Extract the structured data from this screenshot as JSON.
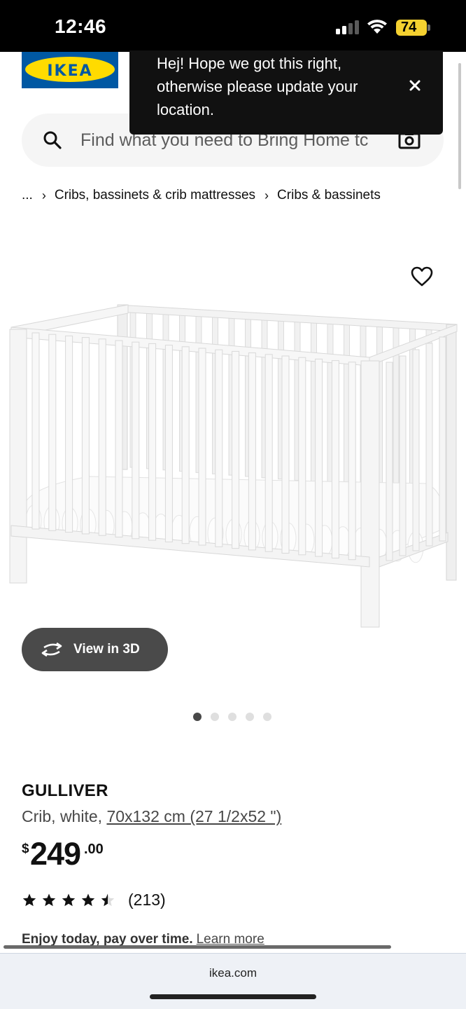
{
  "status_bar": {
    "time": "12:46",
    "battery": "74"
  },
  "header": {
    "logo_text": "IKEA",
    "search": {
      "placeholder": "Find what you need to Bring Home tc"
    }
  },
  "toast": {
    "message": "Hej! Hope we got this right, otherwise please update your location.",
    "close_icon": "close-icon"
  },
  "breadcrumb": {
    "items": [
      "...",
      "Cribs, bassinets & crib mattresses",
      "Cribs & bassinets"
    ],
    "separator": "›"
  },
  "gallery": {
    "view3d_label": "View in 3D",
    "image_count": 5,
    "active_index": 0
  },
  "product": {
    "name": "GULLIVER",
    "desc_prefix": "Crib, white, ",
    "dimensions": "70x132 cm (27 1/2x52 \")",
    "price_currency": "$",
    "price_int": "249",
    "price_dec": ".00",
    "rating": 4.5,
    "rating_max": 5,
    "review_count": "(213)"
  },
  "financing": {
    "text": "Enjoy today, pay over time.",
    "link": "Learn more"
  },
  "browser": {
    "url": "ikea.com"
  },
  "colors": {
    "brand_blue": "#0058a3",
    "brand_yellow": "#ffdb00",
    "toast_bg": "#111111"
  }
}
